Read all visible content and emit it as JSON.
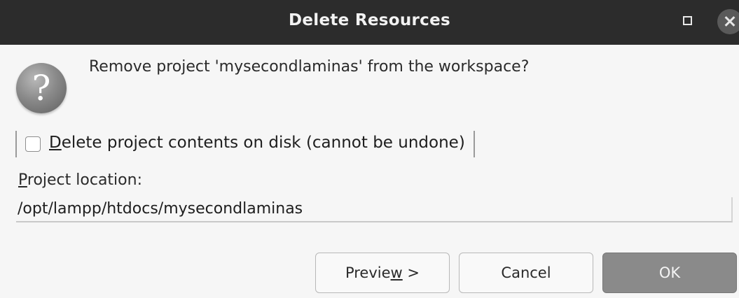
{
  "window": {
    "title": "Delete Resources"
  },
  "dialog": {
    "icon": "question-icon",
    "message": "Remove project 'mysecondlaminas' from the workspace?",
    "delete_contents": {
      "label": "Delete project contents on disk (cannot be undone)",
      "checked": false
    },
    "location_label": "Project location:",
    "location_value": "/opt/lampp/htdocs/mysecondlaminas"
  },
  "buttons": {
    "preview_prefix": "Previe",
    "preview_mnemonic": "w",
    "preview_suffix": " >",
    "cancel": "Cancel",
    "ok": "OK"
  },
  "colors": {
    "titlebar": "#2c2c2c",
    "background": "#f6f6f6",
    "ok_button": "#8a8a8a"
  }
}
